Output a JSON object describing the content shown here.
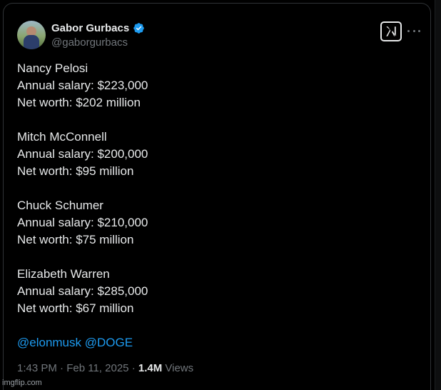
{
  "author": {
    "display_name": "Gabor Gurbacs",
    "handle": "@gaborgurbacs",
    "verified": true
  },
  "tweet": {
    "entries": [
      {
        "name": "Nancy Pelosi",
        "salary": "Annual salary: $223,000",
        "net_worth": "Net worth: $202 million"
      },
      {
        "name": "Mitch McConnell",
        "salary": "Annual salary: $200,000",
        "net_worth": "Net worth: $95 million"
      },
      {
        "name": "Chuck Schumer",
        "salary": "Annual salary: $210,000",
        "net_worth": "Net worth: $75 million"
      },
      {
        "name": "Elizabeth Warren",
        "salary": "Annual salary: $285,000",
        "net_worth": "Net worth: $67 million"
      }
    ],
    "mentions": [
      "@elonmusk",
      "@DOGE"
    ]
  },
  "meta": {
    "time": "1:43 PM",
    "separator": "·",
    "date": "Feb 11, 2025",
    "views_count": "1.4M",
    "views_label": "Views"
  },
  "watermark": "imgflip.com",
  "colors": {
    "background": "#000000",
    "text": "#e7e9ea",
    "muted": "#71767b",
    "link": "#1d9bf0",
    "verified": "#1d9bf0"
  },
  "icons": {
    "verified": "verified-badge-icon",
    "logo": "x-logo-icon",
    "more": "more-icon"
  }
}
